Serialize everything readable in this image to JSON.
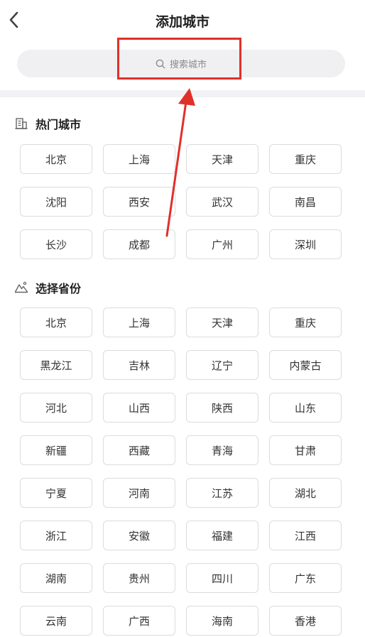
{
  "header": {
    "title": "添加城市",
    "back_icon": "chevron-left-icon"
  },
  "search": {
    "placeholder": "搜索城市",
    "icon": "search-icon"
  },
  "annotation": {
    "highlight_color": "#e0302a"
  },
  "hot_cities": {
    "title": "热门城市",
    "icon": "building-icon",
    "items": [
      "北京",
      "上海",
      "天津",
      "重庆",
      "沈阳",
      "西安",
      "武汉",
      "南昌",
      "长沙",
      "成都",
      "广州",
      "深圳"
    ]
  },
  "provinces": {
    "title": "选择省份",
    "icon": "mountain-icon",
    "items": [
      "北京",
      "上海",
      "天津",
      "重庆",
      "黑龙江",
      "吉林",
      "辽宁",
      "内蒙古",
      "河北",
      "山西",
      "陕西",
      "山东",
      "新疆",
      "西藏",
      "青海",
      "甘肃",
      "宁夏",
      "河南",
      "江苏",
      "湖北",
      "浙江",
      "安徽",
      "福建",
      "江西",
      "湖南",
      "贵州",
      "四川",
      "广东",
      "云南",
      "广西",
      "海南",
      "香港"
    ]
  }
}
